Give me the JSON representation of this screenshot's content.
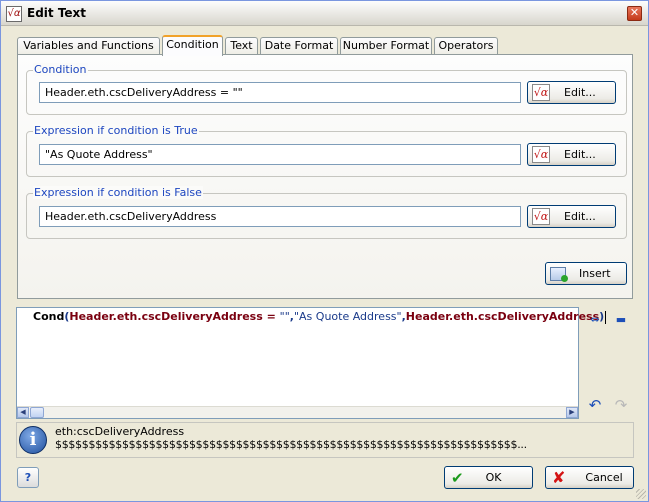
{
  "window": {
    "title": "Edit Text",
    "close_glyph": "✕",
    "app_icon": "√α"
  },
  "tabs": [
    {
      "label": "Variables and Functions"
    },
    {
      "label": "Condition",
      "active": true
    },
    {
      "label": "Text"
    },
    {
      "label": "Date Format"
    },
    {
      "label": "Number Format"
    },
    {
      "label": "Operators"
    }
  ],
  "condition": {
    "legend": "Condition",
    "value": "Header.eth.cscDeliveryAddress = \"\"",
    "edit_label": "Edit..."
  },
  "if_true": {
    "legend": "Expression if condition is True",
    "value": "\"As Quote Address\"",
    "edit_label": "Edit..."
  },
  "if_false": {
    "legend": "Expression if condition is False",
    "value": "Header.eth.cscDeliveryAddress",
    "edit_label": "Edit..."
  },
  "insert_label": "Insert",
  "editor": {
    "fn": "Cond",
    "p_open": "(",
    "field1": "Header.eth.cscDeliveryAddress",
    "op": " = ",
    "str1": "\"\"",
    "comma1": ",",
    "str2": "\"As Quote Address\"",
    "comma2": ",",
    "field2": "Header.eth.cscDeliveryAddress",
    "p_close": ")"
  },
  "info": {
    "line1": "eth:cscDeliveryAddress",
    "line2": "$$$$$$$$$$$$$$$$$$$$$$$$$$$$$$$$$$$$$$$$$$$$$$$$$$$$$$$$$$$$$$$$$$$$$..."
  },
  "help_glyph": "?",
  "ok_label": "OK",
  "cancel_label": "Cancel",
  "icons": {
    "alpha": "√α",
    "ok": "✔",
    "cancel": "✘",
    "undo": "↶",
    "redo": "↷",
    "wrap": "⇔",
    "keyboard": "▬",
    "left": "◀",
    "right": "▶"
  }
}
